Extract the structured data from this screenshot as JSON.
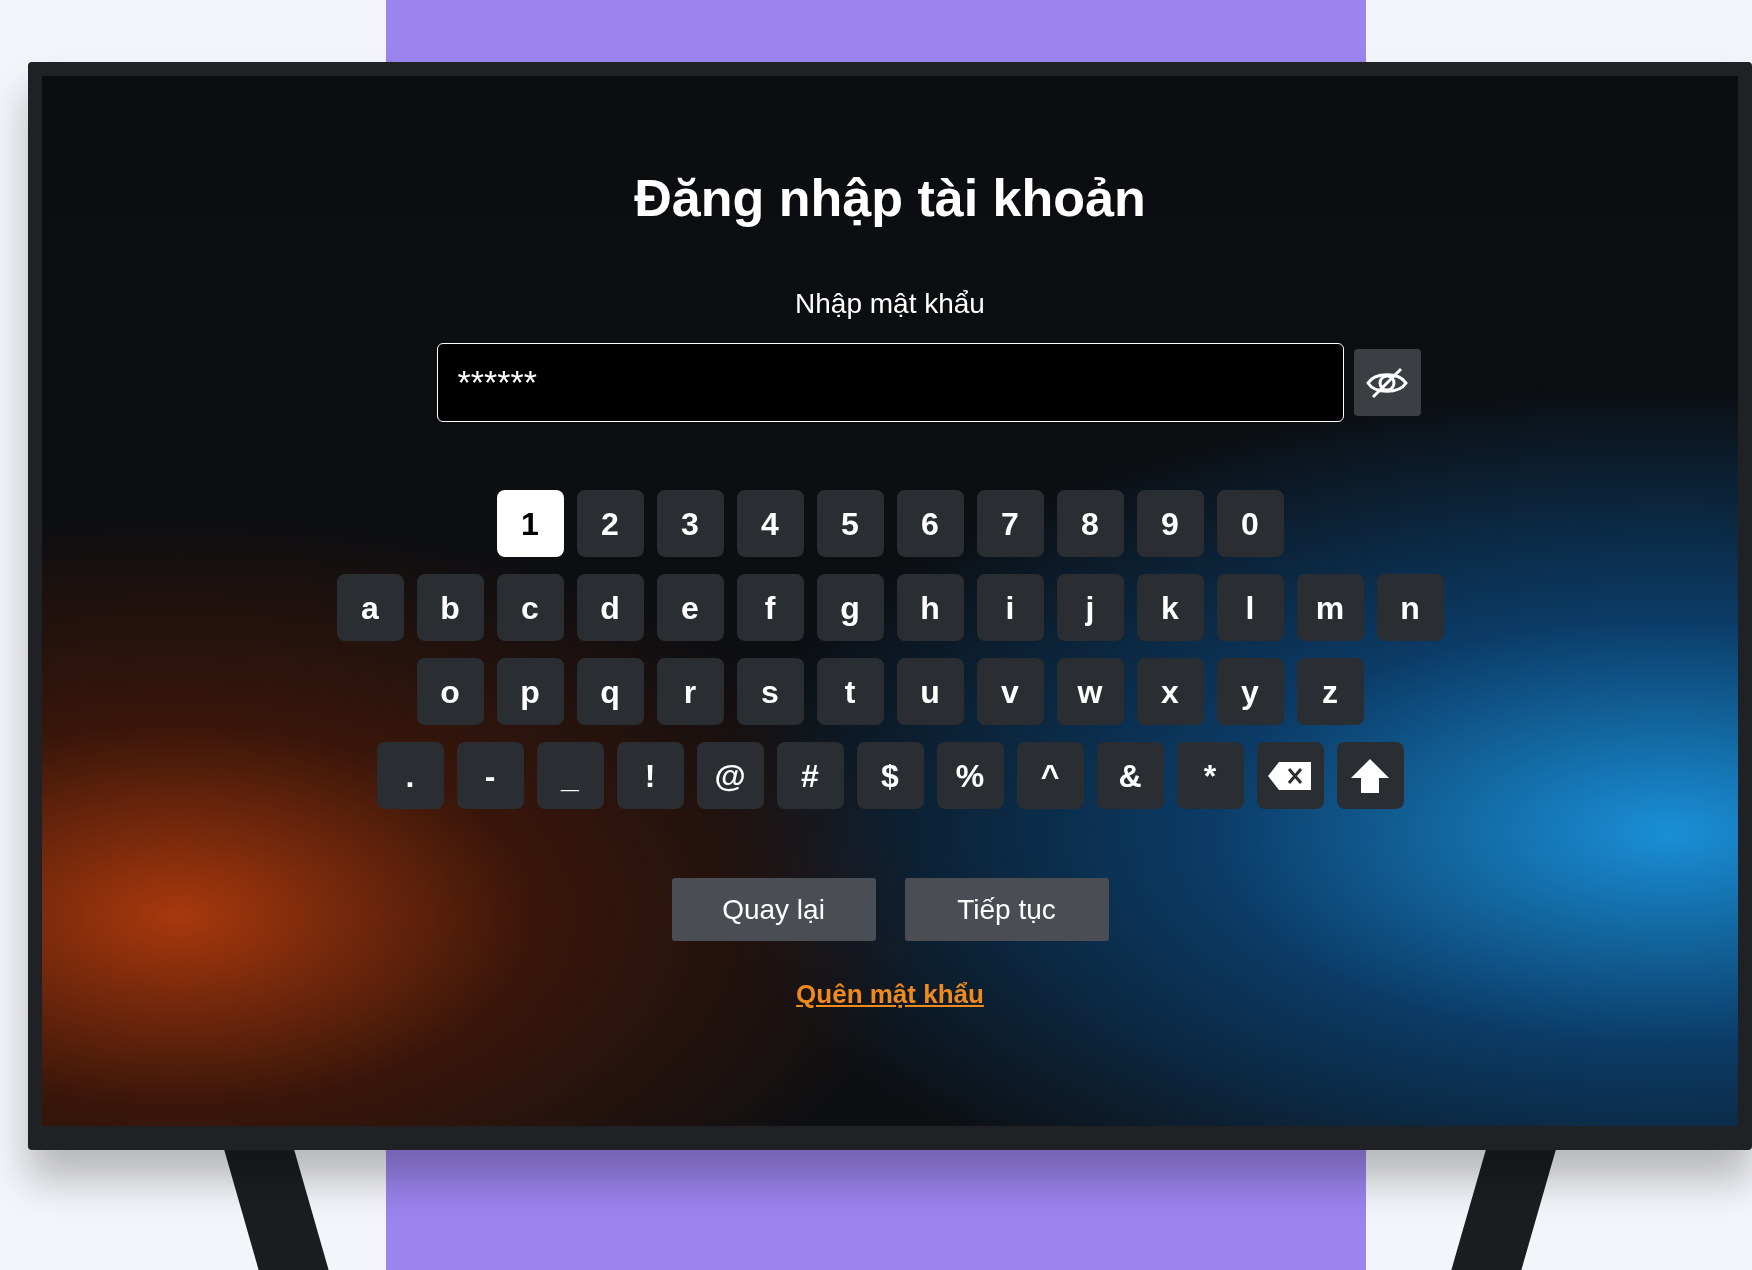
{
  "title": "Đăng nhập tài khoản",
  "password_label": "Nhập mật khẩu",
  "password_field": {
    "value": "******"
  },
  "keyboard": [
    {
      "keys": [
        {
          "kind": "char",
          "label": "1",
          "selected": true
        },
        {
          "kind": "char",
          "label": "2",
          "selected": false
        },
        {
          "kind": "char",
          "label": "3",
          "selected": false
        },
        {
          "kind": "char",
          "label": "4",
          "selected": false
        },
        {
          "kind": "char",
          "label": "5",
          "selected": false
        },
        {
          "kind": "char",
          "label": "6",
          "selected": false
        },
        {
          "kind": "char",
          "label": "7",
          "selected": false
        },
        {
          "kind": "char",
          "label": "8",
          "selected": false
        },
        {
          "kind": "char",
          "label": "9",
          "selected": false
        },
        {
          "kind": "char",
          "label": "0",
          "selected": false
        }
      ]
    },
    {
      "keys": [
        {
          "kind": "char",
          "label": "a",
          "selected": false
        },
        {
          "kind": "char",
          "label": "b",
          "selected": false
        },
        {
          "kind": "char",
          "label": "c",
          "selected": false
        },
        {
          "kind": "char",
          "label": "d",
          "selected": false
        },
        {
          "kind": "char",
          "label": "e",
          "selected": false
        },
        {
          "kind": "char",
          "label": "f",
          "selected": false
        },
        {
          "kind": "char",
          "label": "g",
          "selected": false
        },
        {
          "kind": "char",
          "label": "h",
          "selected": false
        },
        {
          "kind": "char",
          "label": "i",
          "selected": false
        },
        {
          "kind": "char",
          "label": "j",
          "selected": false
        },
        {
          "kind": "char",
          "label": "k",
          "selected": false
        },
        {
          "kind": "char",
          "label": "l",
          "selected": false
        },
        {
          "kind": "char",
          "label": "m",
          "selected": false
        },
        {
          "kind": "char",
          "label": "n",
          "selected": false
        }
      ]
    },
    {
      "keys": [
        {
          "kind": "char",
          "label": "o",
          "selected": false
        },
        {
          "kind": "char",
          "label": "p",
          "selected": false
        },
        {
          "kind": "char",
          "label": "q",
          "selected": false
        },
        {
          "kind": "char",
          "label": "r",
          "selected": false
        },
        {
          "kind": "char",
          "label": "s",
          "selected": false
        },
        {
          "kind": "char",
          "label": "t",
          "selected": false
        },
        {
          "kind": "char",
          "label": "u",
          "selected": false
        },
        {
          "kind": "char",
          "label": "v",
          "selected": false
        },
        {
          "kind": "char",
          "label": "w",
          "selected": false
        },
        {
          "kind": "char",
          "label": "x",
          "selected": false
        },
        {
          "kind": "char",
          "label": "y",
          "selected": false
        },
        {
          "kind": "char",
          "label": "z",
          "selected": false
        }
      ]
    },
    {
      "keys": [
        {
          "kind": "char",
          "label": ".",
          "selected": false
        },
        {
          "kind": "char",
          "label": "-",
          "selected": false
        },
        {
          "kind": "char",
          "label": "_",
          "selected": false
        },
        {
          "kind": "char",
          "label": "!",
          "selected": false
        },
        {
          "kind": "char",
          "label": "@",
          "selected": false
        },
        {
          "kind": "char",
          "label": "#",
          "selected": false
        },
        {
          "kind": "char",
          "label": "$",
          "selected": false
        },
        {
          "kind": "char",
          "label": "%",
          "selected": false
        },
        {
          "kind": "char",
          "label": "^",
          "selected": false
        },
        {
          "kind": "char",
          "label": "&",
          "selected": false
        },
        {
          "kind": "char",
          "label": "*",
          "selected": false
        },
        {
          "kind": "backspace",
          "selected": false
        },
        {
          "kind": "shift",
          "selected": false
        }
      ]
    }
  ],
  "buttons": [
    {
      "label": "Quay lại"
    },
    {
      "label": "Tiếp tục"
    }
  ],
  "forgot_link": "Quên mật khẩu"
}
